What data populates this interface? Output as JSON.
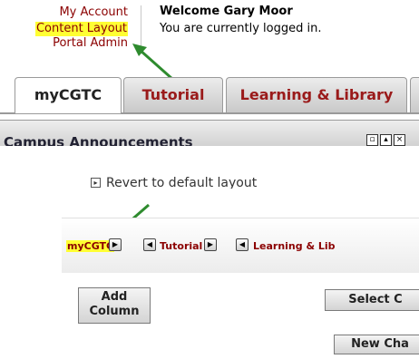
{
  "header": {
    "links": [
      "My Account",
      "Content Layout",
      "Portal Admin"
    ],
    "highlighted_link": "Content Layout",
    "welcome": "Welcome Gary Moor",
    "status": "You are currently logged in."
  },
  "tabs": {
    "items": [
      {
        "label": "myCGTC",
        "active": true
      },
      {
        "label": "Tutorial",
        "active": false
      },
      {
        "label": "Learning & Library",
        "active": false
      }
    ]
  },
  "announcements": {
    "title": "Campus Announcements"
  },
  "layout": {
    "revert_label": "Revert to default layout",
    "tabs": [
      "myCGTC",
      "Tutorial",
      "Learning & Lib"
    ],
    "highlighted_tab": "myCGTC"
  },
  "buttons": {
    "add_column_line1": "Add",
    "add_column_line2": "Column",
    "select_content": "Select C",
    "new_channel": "New Cha"
  },
  "colors": {
    "link": "#8b0000",
    "highlight": "#ffff33",
    "arrow": "#2e8b2e"
  },
  "icons": {
    "arrow_right": "arrow-right-icon",
    "arrow_left": "arrow-left-icon"
  }
}
